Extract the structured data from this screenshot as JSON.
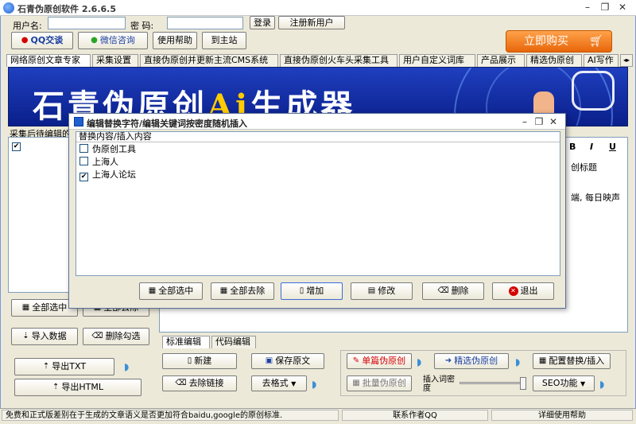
{
  "window": {
    "title": "石青伪原创软件 2.6.6.5",
    "minimize": "–",
    "restore": "❐",
    "close": "✕"
  },
  "login": {
    "username_label": "用户名:",
    "password_label": "密  码:",
    "login_button": "登录",
    "register_button": "注册新用户"
  },
  "toolbar": {
    "qq_button": "QQ交谈",
    "wechat_button": "微信咨询",
    "help_button": "使用帮助",
    "site_button": "到主站",
    "buy_button": "立即购买"
  },
  "tabs": [
    "网络原创文章专家",
    "采集设置",
    "直接伪原创并更新主流CMS系统",
    "直接伪原创火车头采集工具",
    "用户自定义词库",
    "产品展示",
    "精选伪原创",
    "AI写作"
  ],
  "banner": {
    "text_a": "石青伪原创",
    "text_ai": "Ai",
    "text_b": "生成器"
  },
  "left_panel": {
    "header": "采集后待编辑的",
    "select_all": "全部选中",
    "clear_all": "全部去除",
    "import": "导入数据",
    "delete_checked": "删除勾选",
    "export_txt": "导出TXT",
    "export_html": "导出HTML"
  },
  "right_panel": {
    "bold": "B",
    "italic": "I",
    "underline": "U",
    "title_text": "创标题",
    "content_snippet": "端, 每日映声"
  },
  "editor_tabs": {
    "standard": "标准编辑",
    "code": "代码编辑"
  },
  "bottom_buttons": {
    "new": "新建",
    "save_original": "保存原文",
    "remove_links": "去除链接",
    "format": "去格式",
    "single_pseudo": "单篇伪原创",
    "selected_pseudo": "精选伪原创",
    "config_replace": "配置替换/插入",
    "batch_pseudo": "批量伪原创",
    "insert_density": "插入词密度",
    "seo": "SEO功能"
  },
  "dialog": {
    "title": "编辑替换字符/编辑关键词按密度随机插入",
    "list_header": "替换内容/插入内容",
    "items": [
      {
        "label": "伪原创工具",
        "checked": false
      },
      {
        "label": "上海人",
        "checked": false
      },
      {
        "label": "上海人论坛",
        "checked": true
      }
    ],
    "select_all": "全部选中",
    "clear_all": "全部去除",
    "add": "增加",
    "edit": "修改",
    "delete": "删除",
    "exit": "退出"
  },
  "status": {
    "message": "免费和正式版差别在于生成的文章语义是否更加符合baidu,google的原创标准.",
    "contact": "联系作者QQ",
    "manual": "详细使用帮助"
  }
}
